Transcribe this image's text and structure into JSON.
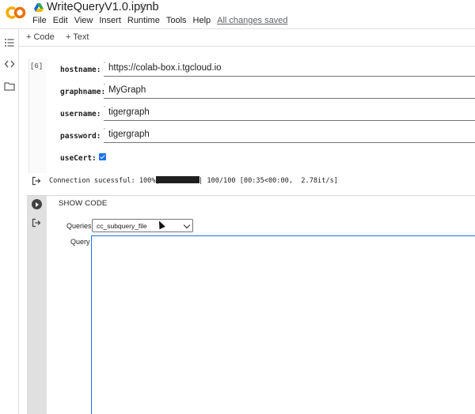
{
  "header": {
    "title": "WriteQueryV1.0.ipynb",
    "menu": [
      "File",
      "Edit",
      "View",
      "Insert",
      "Runtime",
      "Tools",
      "Help"
    ],
    "saved_status": "All changes saved",
    "colors": {
      "logo_orange": "#f9ab00",
      "logo_dark": "#e8710a"
    }
  },
  "toolbar": {
    "code_label": "+ Code",
    "text_label": "+ Text"
  },
  "rail": {
    "icons": [
      "table-of-contents-icon",
      "code-snippets-icon",
      "folder-icon"
    ]
  },
  "cell1": {
    "exec_count": "[6]",
    "fields": [
      {
        "label": "hostname:",
        "value": "https://colab-box.i.tgcloud.io"
      },
      {
        "label": "graphname:",
        "value": "MyGraph"
      },
      {
        "label": "username:",
        "value": "tigergraph"
      },
      {
        "label": "password:",
        "value": "tigergraph"
      }
    ],
    "quote_mark": "\"",
    "usecert_label": "useCert:",
    "usecert_checked": true,
    "output": {
      "prefix": "Connection sucessful: 100%|",
      "suffix": "| 100/100 [00:35<00:00,  2.78it/s]",
      "progress": 1.0
    }
  },
  "cell2": {
    "show_code": "SHOW CODE",
    "queries_label": "Queries",
    "queries_value": "cc_subquery_file",
    "query_label": "Query",
    "query_value": ""
  }
}
